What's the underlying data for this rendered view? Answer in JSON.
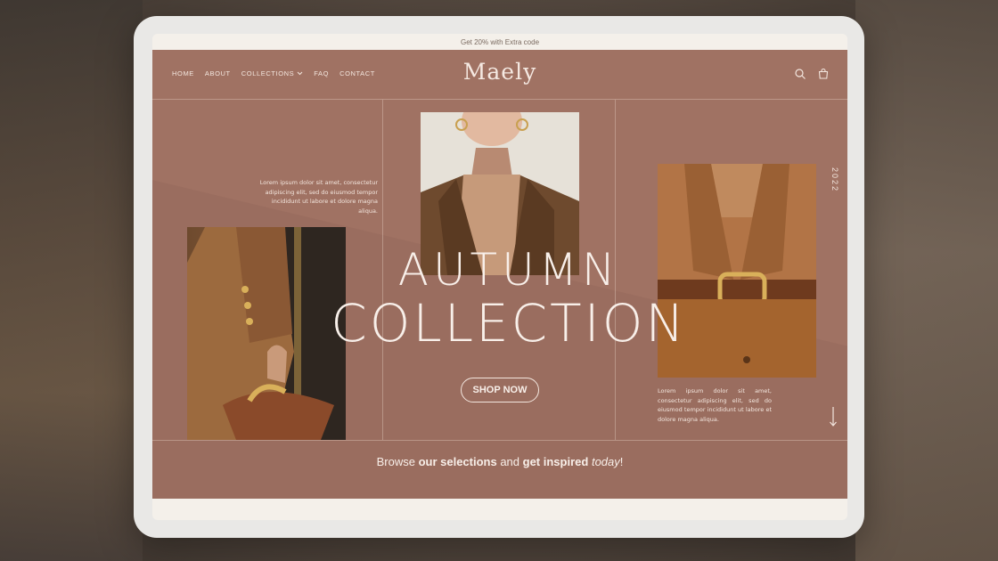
{
  "promo": {
    "text": "Get 20% with Extra code"
  },
  "nav": {
    "links": [
      "HOME",
      "ABOUT",
      "COLLECTIONS",
      "FAQ",
      "CONTACT"
    ],
    "logo": "Maely",
    "icons": [
      "search-icon",
      "cart-icon"
    ]
  },
  "hero": {
    "line1": "AUTUMN",
    "line2": "COLLECTION",
    "cta": "SHOP NOW",
    "year": "2022",
    "lorem_left": "Lorem ipsum dolor sit amet, consectetur adipiscing elit, sed do eiusmod tempor incididunt ut labore et dolore magna aliqua.",
    "lorem_right": "Lorem ipsum dolor sit amet, consectetur adipiscing elit, sed do eiusmod tempor incididunt ut labore et dolore magna aliqua."
  },
  "footer_strip": {
    "part1": "Browse ",
    "bold1": "our selections",
    "part2": " and ",
    "bold2": "get inspired",
    "part3": " ",
    "italic": "today",
    "part4": "!"
  },
  "colors": {
    "brand": "#9a6d5f",
    "text_light": "#f8efe9",
    "promo_bg": "#f4f0ea"
  }
}
